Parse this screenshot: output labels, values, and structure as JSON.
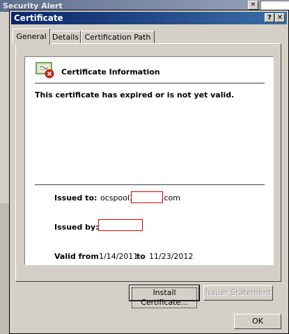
{
  "background_window": {
    "title": "Security Alert",
    "close_label": "✕"
  },
  "dialog": {
    "title": "Certificate",
    "help_label": "?",
    "close_label": "✕"
  },
  "tabs": [
    {
      "label": "General",
      "active": true
    },
    {
      "label": "Details",
      "active": false
    },
    {
      "label": "Certification Path",
      "active": false
    }
  ],
  "info": {
    "title": "Certificate Information",
    "status": "This certificate has expired or is not yet valid.",
    "issued_to_label": "Issued to:",
    "issued_to_prefix": "ocspool3.",
    "issued_to_suffix": ".com",
    "issued_by_label": "Issued by:",
    "valid_from_label": "Valid from",
    "valid_from": "1/14/2011",
    "to_label": "to",
    "valid_to": "11/23/2012"
  },
  "buttons": {
    "install": "Install Certificate...",
    "issuer": "Issuer Statement",
    "ok": "OK"
  },
  "icons": {
    "certificate": "certificate-icon",
    "error_badge": "error-badge-icon"
  }
}
